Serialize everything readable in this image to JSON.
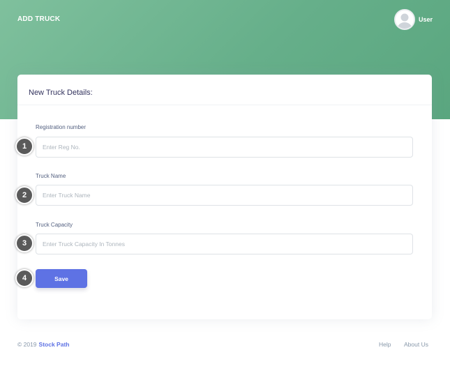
{
  "header": {
    "title": "ADD TRUCK",
    "user_name": "User",
    "avatar_icon": "user-silhouette-icon"
  },
  "colors": {
    "hero_gradient_start": "#7fc09d",
    "hero_gradient_end": "#5aa67f",
    "primary_button": "#5e72e4",
    "step_badge": "#5a5a5a"
  },
  "card": {
    "title": "New Truck Details:",
    "fields": [
      {
        "label": "Registration number",
        "value": "",
        "placeholder": "Enter Reg No."
      },
      {
        "label": "Truck Name",
        "value": "",
        "placeholder": "Enter Truck Name"
      },
      {
        "label": "Truck Capacity",
        "value": "",
        "placeholder": "Enter Truck Capacity In Tonnes"
      }
    ],
    "save_label": "Save"
  },
  "steps": [
    "1",
    "2",
    "3",
    "4"
  ],
  "footer": {
    "copyright": "© 2019",
    "brand": "Stock Path",
    "links": [
      "Help",
      "About Us"
    ]
  }
}
